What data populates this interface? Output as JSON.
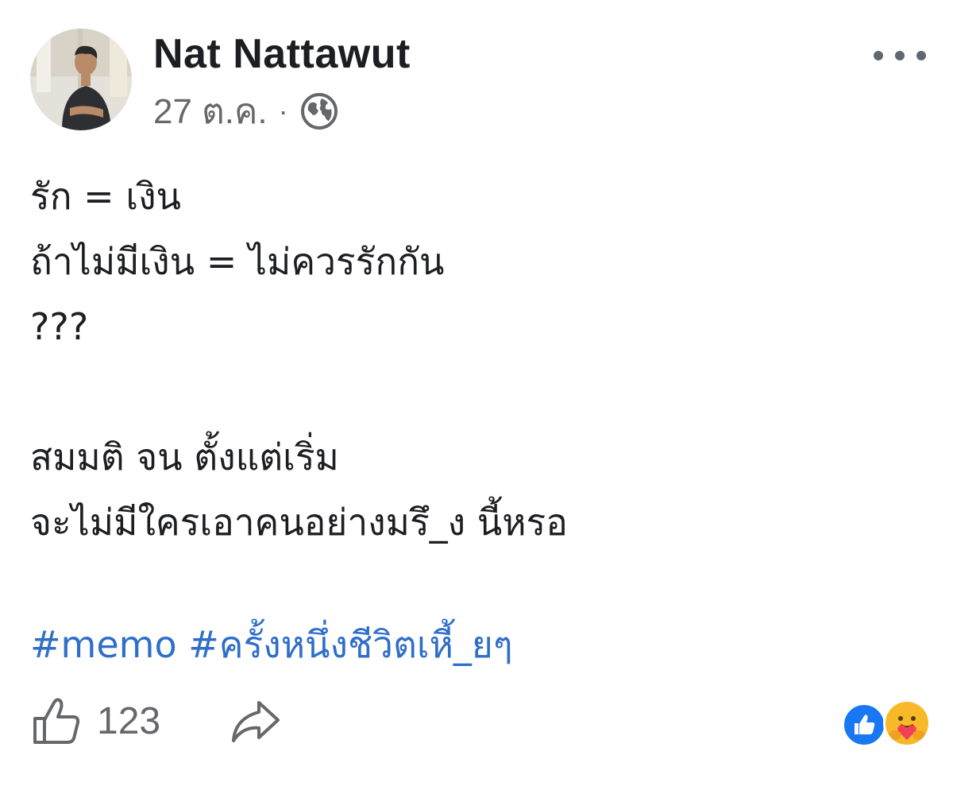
{
  "post": {
    "author": {
      "name": "Nat Nattawut",
      "avatar_icon": "profile-photo"
    },
    "date": "27 ต.ค.",
    "separator": "·",
    "privacy_icon": "globe-icon",
    "more_icon": "more-dots-icon",
    "text_lines": [
      "รัก = เงิน",
      "ถ้าไม่มีเงิน = ไม่ควรรักกัน",
      "???",
      "",
      "สมมติ จน ตั้งแต่เริ่ม",
      "จะไม่มีใครเอาคนอย่างมรึ_ง นี้หรอ"
    ],
    "hashtags": [
      "#memo",
      "#ครั้งหนึ่งชีวิตเหี้_ยๆ"
    ],
    "like_count": "123",
    "reactions": [
      "like-reaction-icon",
      "care-reaction-icon"
    ],
    "colors": {
      "hashtag": "#2f6ec9",
      "meta_gray": "#65676b",
      "like_blue": "#1877f2",
      "care_yellow": "#f7b928"
    }
  }
}
